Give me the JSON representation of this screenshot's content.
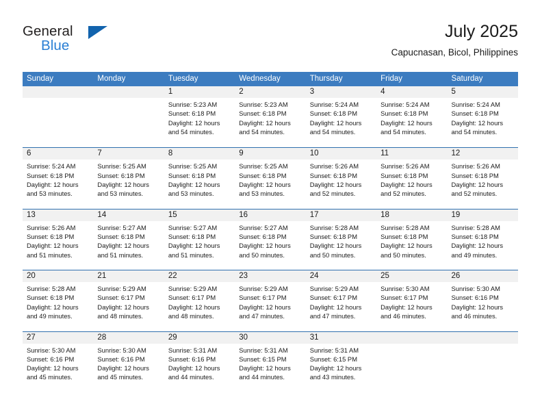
{
  "brand": {
    "name_part1": "General",
    "name_part2": "Blue",
    "logo_icon": "triangle-logo-icon"
  },
  "header": {
    "title": "July 2025",
    "location": "Capucnasan, Bicol, Philippines"
  },
  "colors": {
    "header_blue": "#3c7cc0",
    "row_divider_blue": "#2f6fae",
    "date_band_gray": "#f1f1f1",
    "brand_blue": "#2a7fd4",
    "logo_blue": "#1263ad",
    "text": "#1a1a1a"
  },
  "calendar": {
    "weekdays": [
      "Sunday",
      "Monday",
      "Tuesday",
      "Wednesday",
      "Thursday",
      "Friday",
      "Saturday"
    ],
    "weeks": [
      [
        {
          "day": "",
          "lines": []
        },
        {
          "day": "",
          "lines": []
        },
        {
          "day": "1",
          "lines": [
            "Sunrise: 5:23 AM",
            "Sunset: 6:18 PM",
            "Daylight: 12 hours",
            "and 54 minutes."
          ]
        },
        {
          "day": "2",
          "lines": [
            "Sunrise: 5:23 AM",
            "Sunset: 6:18 PM",
            "Daylight: 12 hours",
            "and 54 minutes."
          ]
        },
        {
          "day": "3",
          "lines": [
            "Sunrise: 5:24 AM",
            "Sunset: 6:18 PM",
            "Daylight: 12 hours",
            "and 54 minutes."
          ]
        },
        {
          "day": "4",
          "lines": [
            "Sunrise: 5:24 AM",
            "Sunset: 6:18 PM",
            "Daylight: 12 hours",
            "and 54 minutes."
          ]
        },
        {
          "day": "5",
          "lines": [
            "Sunrise: 5:24 AM",
            "Sunset: 6:18 PM",
            "Daylight: 12 hours",
            "and 54 minutes."
          ]
        }
      ],
      [
        {
          "day": "6",
          "lines": [
            "Sunrise: 5:24 AM",
            "Sunset: 6:18 PM",
            "Daylight: 12 hours",
            "and 53 minutes."
          ]
        },
        {
          "day": "7",
          "lines": [
            "Sunrise: 5:25 AM",
            "Sunset: 6:18 PM",
            "Daylight: 12 hours",
            "and 53 minutes."
          ]
        },
        {
          "day": "8",
          "lines": [
            "Sunrise: 5:25 AM",
            "Sunset: 6:18 PM",
            "Daylight: 12 hours",
            "and 53 minutes."
          ]
        },
        {
          "day": "9",
          "lines": [
            "Sunrise: 5:25 AM",
            "Sunset: 6:18 PM",
            "Daylight: 12 hours",
            "and 53 minutes."
          ]
        },
        {
          "day": "10",
          "lines": [
            "Sunrise: 5:26 AM",
            "Sunset: 6:18 PM",
            "Daylight: 12 hours",
            "and 52 minutes."
          ]
        },
        {
          "day": "11",
          "lines": [
            "Sunrise: 5:26 AM",
            "Sunset: 6:18 PM",
            "Daylight: 12 hours",
            "and 52 minutes."
          ]
        },
        {
          "day": "12",
          "lines": [
            "Sunrise: 5:26 AM",
            "Sunset: 6:18 PM",
            "Daylight: 12 hours",
            "and 52 minutes."
          ]
        }
      ],
      [
        {
          "day": "13",
          "lines": [
            "Sunrise: 5:26 AM",
            "Sunset: 6:18 PM",
            "Daylight: 12 hours",
            "and 51 minutes."
          ]
        },
        {
          "day": "14",
          "lines": [
            "Sunrise: 5:27 AM",
            "Sunset: 6:18 PM",
            "Daylight: 12 hours",
            "and 51 minutes."
          ]
        },
        {
          "day": "15",
          "lines": [
            "Sunrise: 5:27 AM",
            "Sunset: 6:18 PM",
            "Daylight: 12 hours",
            "and 51 minutes."
          ]
        },
        {
          "day": "16",
          "lines": [
            "Sunrise: 5:27 AM",
            "Sunset: 6:18 PM",
            "Daylight: 12 hours",
            "and 50 minutes."
          ]
        },
        {
          "day": "17",
          "lines": [
            "Sunrise: 5:28 AM",
            "Sunset: 6:18 PM",
            "Daylight: 12 hours",
            "and 50 minutes."
          ]
        },
        {
          "day": "18",
          "lines": [
            "Sunrise: 5:28 AM",
            "Sunset: 6:18 PM",
            "Daylight: 12 hours",
            "and 50 minutes."
          ]
        },
        {
          "day": "19",
          "lines": [
            "Sunrise: 5:28 AM",
            "Sunset: 6:18 PM",
            "Daylight: 12 hours",
            "and 49 minutes."
          ]
        }
      ],
      [
        {
          "day": "20",
          "lines": [
            "Sunrise: 5:28 AM",
            "Sunset: 6:18 PM",
            "Daylight: 12 hours",
            "and 49 minutes."
          ]
        },
        {
          "day": "21",
          "lines": [
            "Sunrise: 5:29 AM",
            "Sunset: 6:17 PM",
            "Daylight: 12 hours",
            "and 48 minutes."
          ]
        },
        {
          "day": "22",
          "lines": [
            "Sunrise: 5:29 AM",
            "Sunset: 6:17 PM",
            "Daylight: 12 hours",
            "and 48 minutes."
          ]
        },
        {
          "day": "23",
          "lines": [
            "Sunrise: 5:29 AM",
            "Sunset: 6:17 PM",
            "Daylight: 12 hours",
            "and 47 minutes."
          ]
        },
        {
          "day": "24",
          "lines": [
            "Sunrise: 5:29 AM",
            "Sunset: 6:17 PM",
            "Daylight: 12 hours",
            "and 47 minutes."
          ]
        },
        {
          "day": "25",
          "lines": [
            "Sunrise: 5:30 AM",
            "Sunset: 6:17 PM",
            "Daylight: 12 hours",
            "and 46 minutes."
          ]
        },
        {
          "day": "26",
          "lines": [
            "Sunrise: 5:30 AM",
            "Sunset: 6:16 PM",
            "Daylight: 12 hours",
            "and 46 minutes."
          ]
        }
      ],
      [
        {
          "day": "27",
          "lines": [
            "Sunrise: 5:30 AM",
            "Sunset: 6:16 PM",
            "Daylight: 12 hours",
            "and 45 minutes."
          ]
        },
        {
          "day": "28",
          "lines": [
            "Sunrise: 5:30 AM",
            "Sunset: 6:16 PM",
            "Daylight: 12 hours",
            "and 45 minutes."
          ]
        },
        {
          "day": "29",
          "lines": [
            "Sunrise: 5:31 AM",
            "Sunset: 6:16 PM",
            "Daylight: 12 hours",
            "and 44 minutes."
          ]
        },
        {
          "day": "30",
          "lines": [
            "Sunrise: 5:31 AM",
            "Sunset: 6:15 PM",
            "Daylight: 12 hours",
            "and 44 minutes."
          ]
        },
        {
          "day": "31",
          "lines": [
            "Sunrise: 5:31 AM",
            "Sunset: 6:15 PM",
            "Daylight: 12 hours",
            "and 43 minutes."
          ]
        },
        {
          "day": "",
          "lines": []
        },
        {
          "day": "",
          "lines": []
        }
      ]
    ]
  }
}
